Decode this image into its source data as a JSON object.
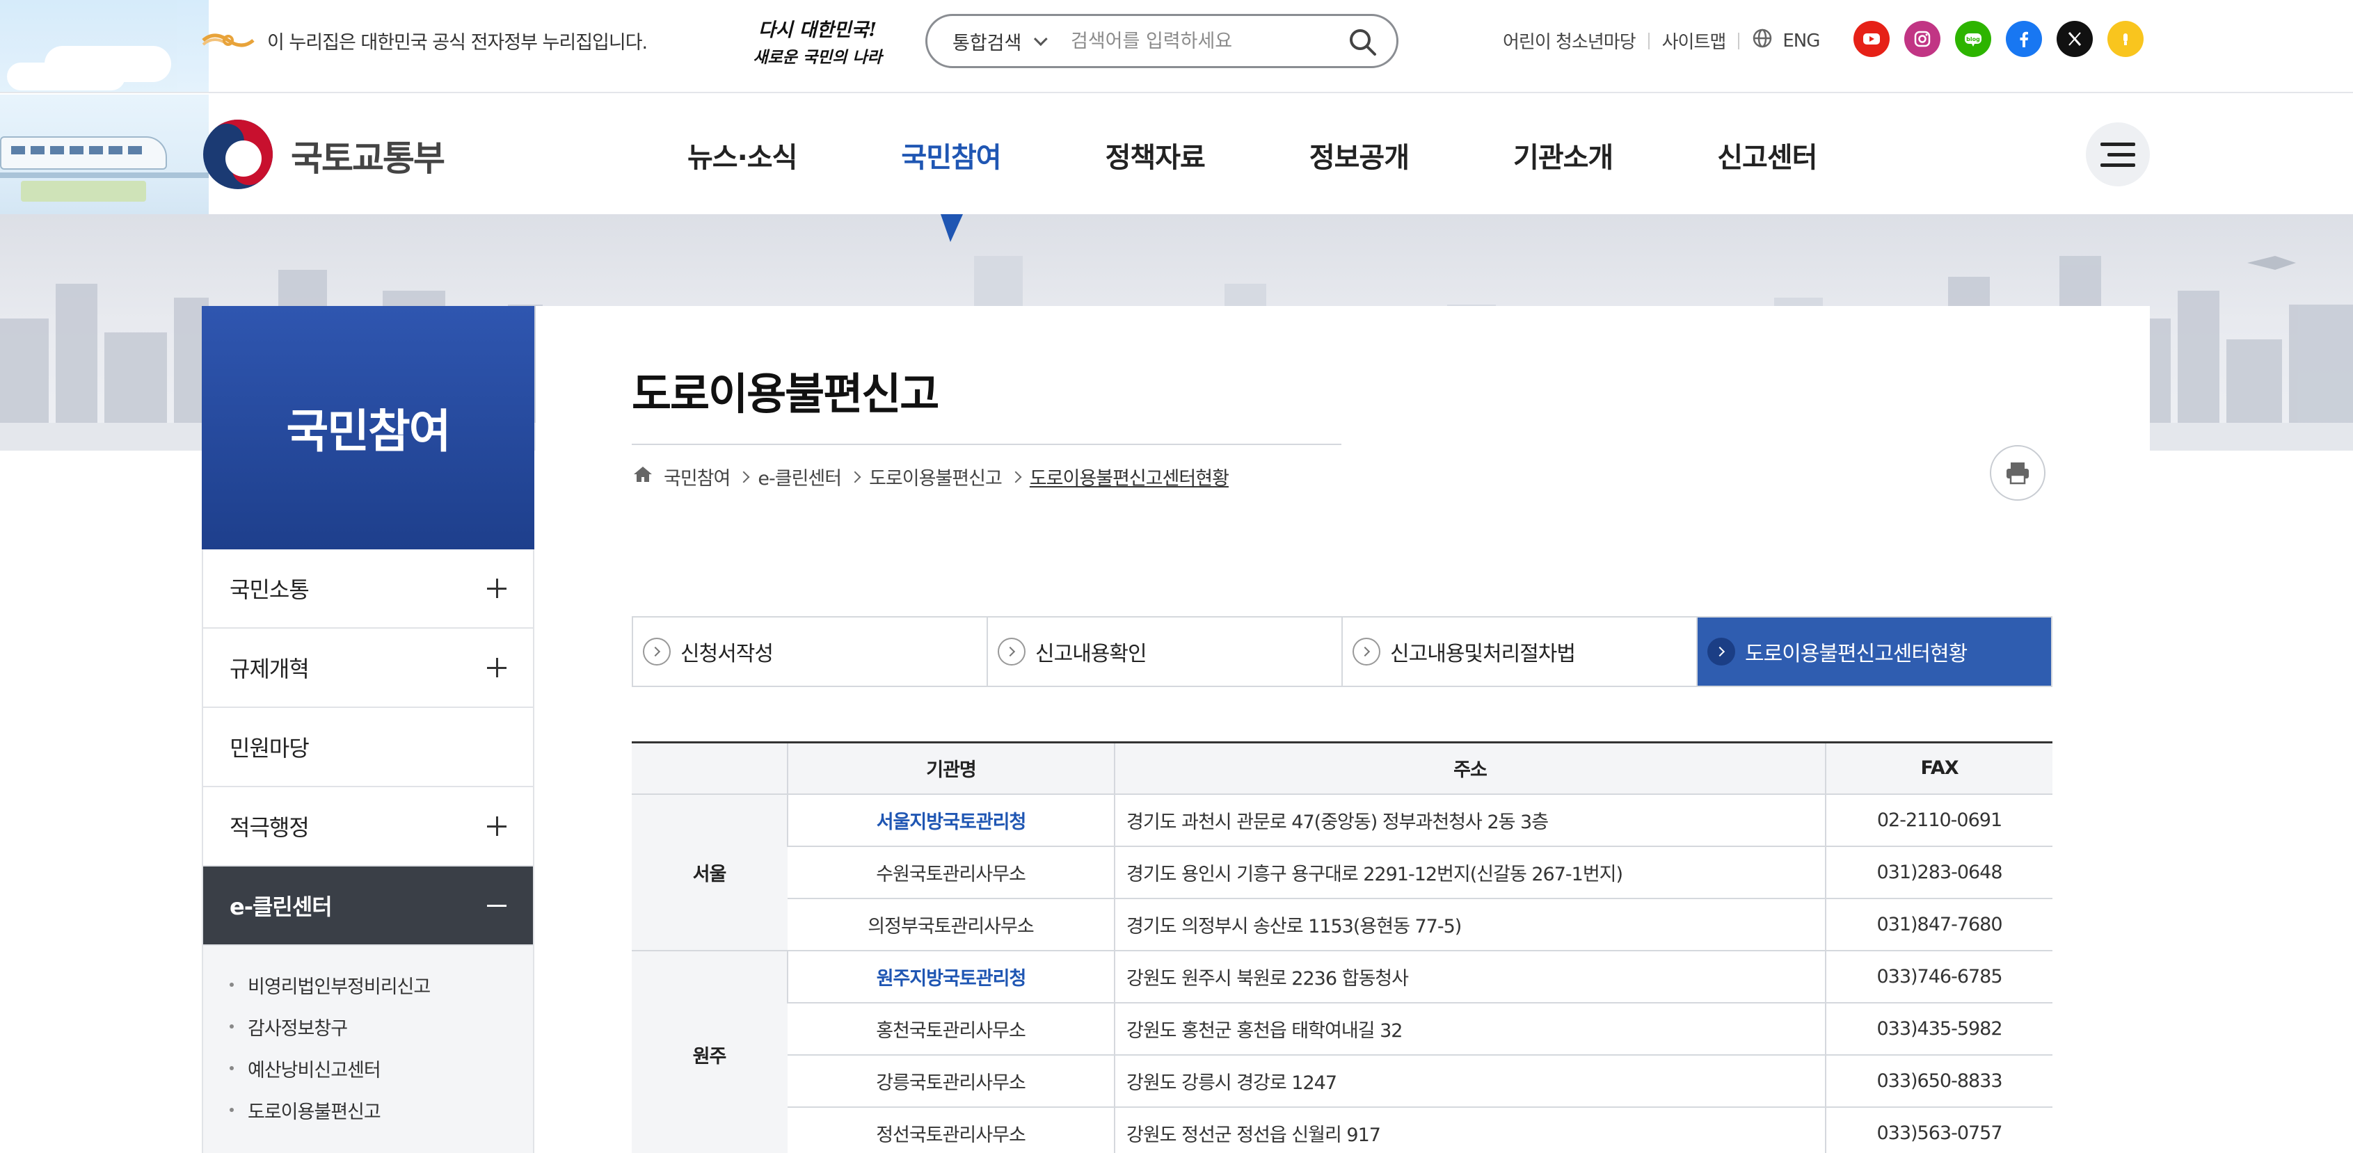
{
  "utility": {
    "gov_notice": "이 누리집은 대한민국 공식 전자정부 누리집입니다.",
    "slogan_line1": "다시 대한민국!",
    "slogan_line2": "새로운 국민의 나라",
    "search_scope": "통합검색",
    "search_placeholder": "검색어를 입력하세요",
    "links": [
      "어린이 청소년마당",
      "사이트맵"
    ],
    "lang": "ENG",
    "sns": [
      {
        "name": "youtube-icon",
        "color": "#e62117"
      },
      {
        "name": "instagram-icon",
        "color": "#c13584"
      },
      {
        "name": "blog-icon",
        "color": "#2db400"
      },
      {
        "name": "facebook-icon",
        "color": "#1877f2"
      },
      {
        "name": "x-icon",
        "color": "#111111"
      },
      {
        "name": "kakao-icon",
        "color": "#f9c51e"
      }
    ]
  },
  "header": {
    "brand": "국토교통부",
    "menus": [
      "뉴스·소식",
      "국민참여",
      "정책자료",
      "정보공개",
      "기관소개",
      "신고센터"
    ],
    "active_menu": "국민참여",
    "accent_color": "#1f56b3"
  },
  "sidebar": {
    "title": "국민참여",
    "items": [
      {
        "label": "국민소통",
        "expandable": true
      },
      {
        "label": "규제개혁",
        "expandable": true
      },
      {
        "label": "민원마당",
        "expandable": false
      },
      {
        "label": "적극행정",
        "expandable": true
      },
      {
        "label": "e-클린센터",
        "expandable": true,
        "open": true
      }
    ],
    "sub_items": [
      "비영리법인부정비리신고",
      "감사정보창구",
      "예산낭비신고센터",
      "도로이용불편신고"
    ]
  },
  "main": {
    "title": "도로이용불편신고",
    "breadcrumb": [
      "국민참여",
      "e-클린센터",
      "도로이용불편신고",
      "도로이용불편신고센터현황"
    ],
    "tabs": [
      "신청서작성",
      "신고내용확인",
      "신고내용및처리절차법",
      "도로이용불편신고센터현황"
    ],
    "active_tab": 3,
    "table": {
      "headers": [
        "기관명",
        "주소",
        "FAX"
      ],
      "regions": [
        {
          "name": "서울",
          "rows": [
            {
              "org": "서울지방국토관리청",
              "addr": "경기도 과천시 관문로 47(중앙동) 정부과천청사 2동 3층",
              "fax": "02-2110-0691",
              "link": true
            },
            {
              "org": "수원국토관리사무소",
              "addr": "경기도 용인시 기흥구 용구대로 2291-12번지(신갈동 267-1번지)",
              "fax": "031)283-0648",
              "link": false
            },
            {
              "org": "의정부국토관리사무소",
              "addr": "경기도 의정부시 송산로 1153(용현동 77-5)",
              "fax": "031)847-7680",
              "link": false
            }
          ]
        },
        {
          "name": "원주",
          "rows": [
            {
              "org": "원주지방국토관리청",
              "addr": "강원도 원주시 북원로 2236 합동청사",
              "fax": "033)746-6785",
              "link": true
            },
            {
              "org": "홍천국토관리사무소",
              "addr": "강원도 홍천군 홍천읍 태학여내길 32",
              "fax": "033)435-5982",
              "link": false
            },
            {
              "org": "강릉국토관리사무소",
              "addr": "강원도 강릉시 경강로 1247",
              "fax": "033)650-8833",
              "link": false
            },
            {
              "org": "정선국토관리사무소",
              "addr": "강원도 정선군 정선읍 신월리 917",
              "fax": "033)563-0757",
              "link": false
            }
          ]
        }
      ]
    }
  }
}
